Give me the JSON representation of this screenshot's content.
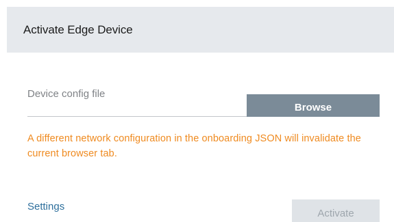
{
  "dialog": {
    "title": "Activate Edge Device"
  },
  "config_field": {
    "label": "Device config file",
    "browse_label": "Browse"
  },
  "warning": {
    "text": "A different network configuration in the onboarding JSON will invalidate the current browser tab."
  },
  "footer": {
    "settings_label": "Settings",
    "activate_label": "Activate",
    "activate_enabled": false
  },
  "colors": {
    "header_bg": "#e6e9ed",
    "browse_bg": "#7b8b98",
    "warning": "#ef8a1f",
    "link": "#2e6f9c",
    "disabled_bg": "#dfe3e7"
  }
}
